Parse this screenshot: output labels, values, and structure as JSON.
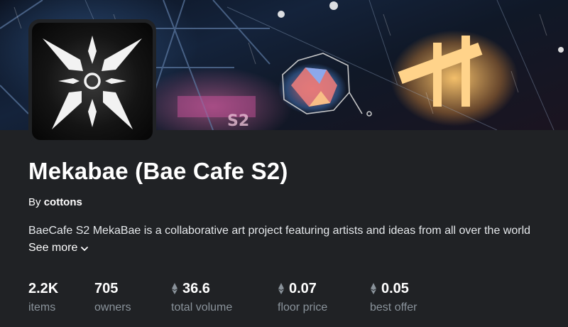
{
  "collection": {
    "title": "Mekabae (Bae Cafe S2)",
    "by_prefix": "By",
    "creator": "cottons",
    "description": "BaeCafe S2 MekaBae is a collaborative art project featuring artists and ideas from all over the world",
    "see_more": "See more"
  },
  "banner": {
    "neon_text": "S2"
  },
  "icons": {
    "logo": "mekabae-star-logo",
    "currency": "ethereum-icon",
    "see_more": "chevron-down-icon"
  },
  "stats": [
    {
      "value": "2.2K",
      "label": "items",
      "currency": false
    },
    {
      "value": "705",
      "label": "owners",
      "currency": false
    },
    {
      "value": "36.6",
      "label": "total volume",
      "currency": true
    },
    {
      "value": "0.07",
      "label": "floor price",
      "currency": true
    },
    {
      "value": "0.05",
      "label": "best offer",
      "currency": true
    }
  ],
  "colors": {
    "background": "#202225",
    "text": "#ffffff",
    "muted": "#8a939b"
  }
}
